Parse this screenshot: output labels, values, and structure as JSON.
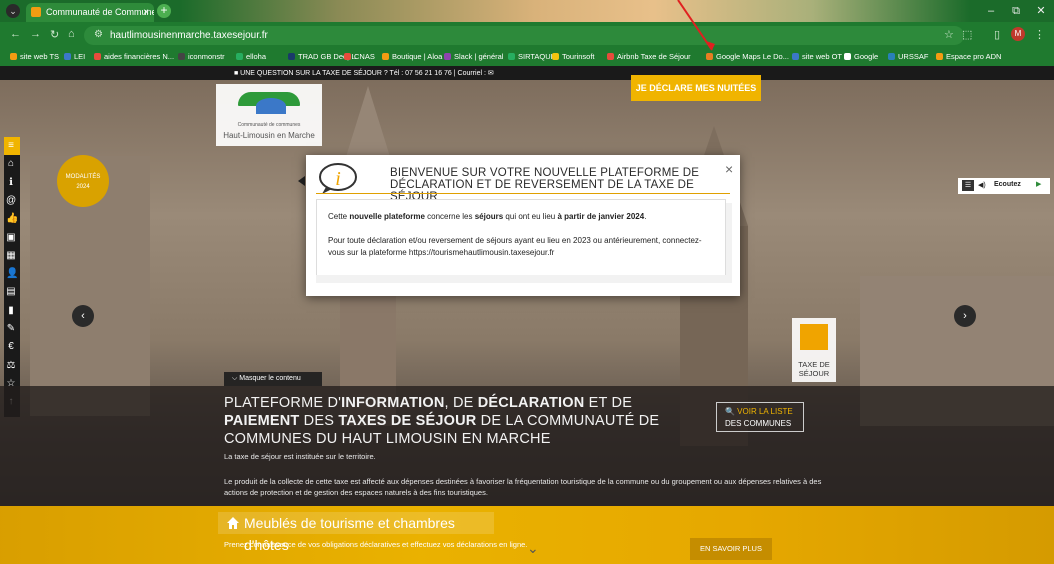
{
  "browser": {
    "tab_title": "Communauté de Communes d",
    "tab_close": "×",
    "new_tab": "+",
    "url": "hautlimousinenmarche.taxesejour.fr",
    "window_controls": [
      "–",
      "⧉",
      "✕"
    ],
    "profile_initial": "M",
    "bookmarks": [
      {
        "label": "site web TS",
        "color": "#f39c12"
      },
      {
        "label": "LEI",
        "color": "#3b78c8"
      },
      {
        "label": "aides financières N...",
        "color": "#e74c3c"
      },
      {
        "label": "iconmonstr",
        "color": "#444444"
      },
      {
        "label": "elloha",
        "color": "#27ae60"
      },
      {
        "label": "TRAD GB DeepL",
        "color": "#1a3a6a"
      },
      {
        "label": "CNAS",
        "color": "#e74c3c"
      },
      {
        "label": "Boutique | Aloa",
        "color": "#f39c12"
      },
      {
        "label": "Slack | général",
        "color": "#8e44ad"
      },
      {
        "label": "SIRTAQUI",
        "color": "#27ae60"
      },
      {
        "label": "Tourinsoft",
        "color": "#f1c40f"
      },
      {
        "label": "Airbnb Taxe de Séjour",
        "color": "#e74c3c"
      },
      {
        "label": "Google Maps Le Do...",
        "color": "#e67e22"
      },
      {
        "label": "site web OT",
        "color": "#3b78c8"
      },
      {
        "label": "Google",
        "color": "#ffffff"
      },
      {
        "label": "URSSAF",
        "color": "#2980b9"
      },
      {
        "label": "Espace pro ADN",
        "color": "#f39c12"
      }
    ]
  },
  "site": {
    "infobar": "■ UNE QUESTION SUR LA TAXE DE SÉJOUR ? Tél : 07 56 21 16 76 | Courriel : ✉",
    "declare_button": "JE DÉCLARE MES NUITÉES",
    "logo_line1": "Communauté de communes",
    "logo_line2": "Haut-Limousin en Marche",
    "modalites_badge_line1": "MODALITÉS",
    "modalites_badge_line2": "2024",
    "ecoutez": "Ecoutez",
    "taxe_badge_line1": "TAXE DE",
    "taxe_badge_line2": "SÉJOUR",
    "mask_button": "⌵  Masquer le contenu",
    "headline_parts": [
      {
        "text": "PLATEFORME D'",
        "bold": false
      },
      {
        "text": "INFORMATION",
        "bold": true
      },
      {
        "text": ", DE ",
        "bold": false
      },
      {
        "text": "DÉCLARATION",
        "bold": true
      },
      {
        "text": " ET DE ",
        "bold": false
      },
      {
        "text": "PAIEMENT",
        "bold": true
      },
      {
        "text": " DES ",
        "bold": false
      },
      {
        "text": "TAXES DE SÉJOUR",
        "bold": true
      },
      {
        "text": " DE LA COMMUNAUTÉ DE COMMUNES DU HAUT LIMOUSIN EN MARCHE",
        "bold": false
      }
    ],
    "voir_line1": "🔍 VOIR LA LISTE",
    "voir_line2": "DES COMMUNES",
    "para1": "La taxe de séjour est instituée sur le territoire.",
    "para2": "Le produit de la collecte de cette taxe est affecté aux dépenses destinées à favoriser la fréquentation touristique de la commune ou du groupement ou aux dépenses relatives à des actions de protection et de gestion des espaces naturels à des fins touristiques.",
    "meubles_title": "Meublés de tourisme et chambres d'hôtes",
    "meubles_text": "Prenez connaissance de vos obligations déclaratives et effectuez vos déclarations en ligne.",
    "en_savoir_plus": "EN SAVOIR PLUS",
    "sidebar_icons": [
      "≡",
      "⌂",
      "ℹ",
      "@",
      "👍",
      "▣",
      "▦",
      "👤",
      "▤",
      "▮",
      "✎",
      "€",
      "⚖",
      "☆",
      "↑"
    ]
  },
  "modal": {
    "title_line1": "BIENVENUE SUR VOTRE NOUVELLE PLATEFORME DE",
    "title_line2": "DÉCLARATION ET DE REVERSEMENT DE LA TAXE DE SÉJOUR",
    "close": "×",
    "p1_before": "Cette ",
    "p1_bold1": "nouvelle plateforme",
    "p1_mid": " concerne les ",
    "p1_bold2": "séjours",
    "p1_mid2": " qui ont eu lieu ",
    "p1_bold3": "à partir de janvier 2024",
    "p1_end": ".",
    "p2": "Pour toute déclaration et/ou reversement de séjours ayant eu lieu en 2023 ou antérieurement, connectez-vous sur la plateforme https://tourismehautlimousin.taxesejour.fr"
  }
}
